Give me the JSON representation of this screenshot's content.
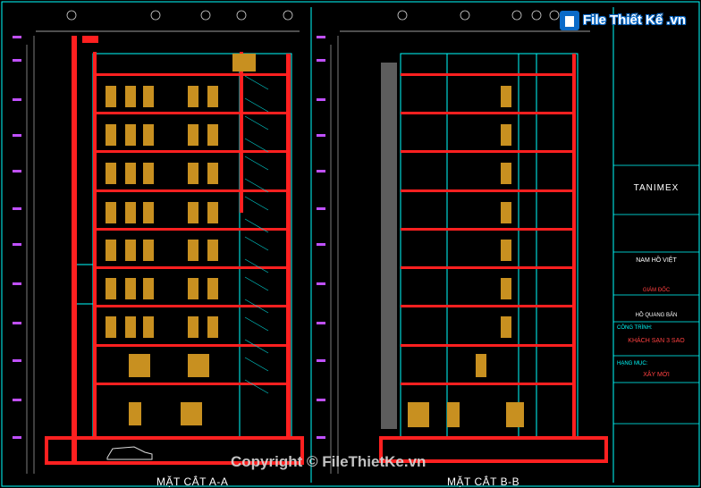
{
  "sections": {
    "a": {
      "title": "MẶT CẮT A-A"
    },
    "b": {
      "title": "MẶT CẮT B-B"
    }
  },
  "title_block": {
    "company": "TANIMEX",
    "partner": "NAM HỒ VIỆT",
    "director_role": "GIÁM ĐỐC",
    "director_name": "HỒ QUANG BẢN",
    "project_label": "CÔNG TRÌNH:",
    "project_name": "KHÁCH SẠN 3 SAO",
    "category_label": "HẠNG MỤC:",
    "category_value": "XÂY MỚI"
  },
  "watermark": {
    "logo_text": "File Thiết Kế .vn",
    "copyright": "Copyright © FileThietKe.vn"
  },
  "colors": {
    "background": "#000000",
    "wall": "#ff2020",
    "outline": "#00ffff",
    "window": "#c89020",
    "stair": "#00c8c8"
  }
}
